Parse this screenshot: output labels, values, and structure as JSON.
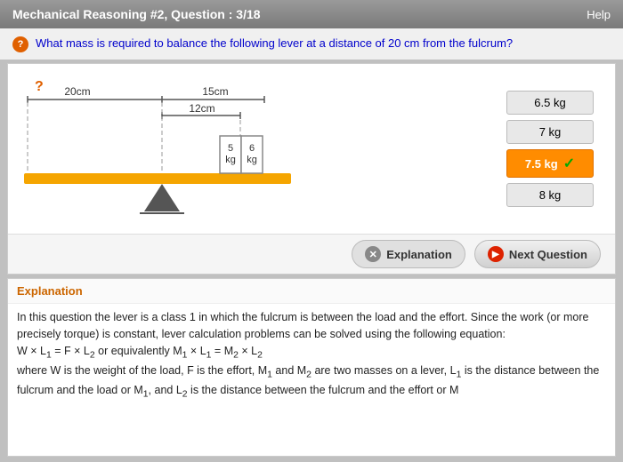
{
  "header": {
    "title": "Mechanical Reasoning #2, Question : 3/18",
    "help_label": "Help"
  },
  "question": {
    "icon": "?",
    "text": "What mass is required to balance the following lever at a distance of 20 cm from the fulcrum?"
  },
  "diagram": {
    "dim1_label": "20cm",
    "dim2_label": "15cm",
    "dim3_label": "12cm",
    "mass1_label": "5\nkg",
    "mass2_label": "6\nkg",
    "question_mark": "?"
  },
  "answers": [
    {
      "label": "6.5 kg",
      "selected": false
    },
    {
      "label": "7 kg",
      "selected": false
    },
    {
      "label": "7.5 kg",
      "selected": true
    },
    {
      "label": "8 kg",
      "selected": false
    }
  ],
  "buttons": {
    "explanation_label": "Explanation",
    "next_label": "Next Question"
  },
  "explanation": {
    "title": "Explanation",
    "content": "In this question the lever is a class 1 in which the fulcrum is between the load and the effort. Since the work (or more precisely torque) is constant, lever calculation problems can be solved using the following equation:\nW × L₁ = F × L₂ or equivalently M₁ × L₁ = M₂ × L₂\nwhere W is the weight of the load, F is the effort, M₁ and M₂ are two masses on a lever, L₁ is the distance between the fulcrum and the load or M₁, and L₂ is the distance between the fulcrum and the effort or M"
  }
}
